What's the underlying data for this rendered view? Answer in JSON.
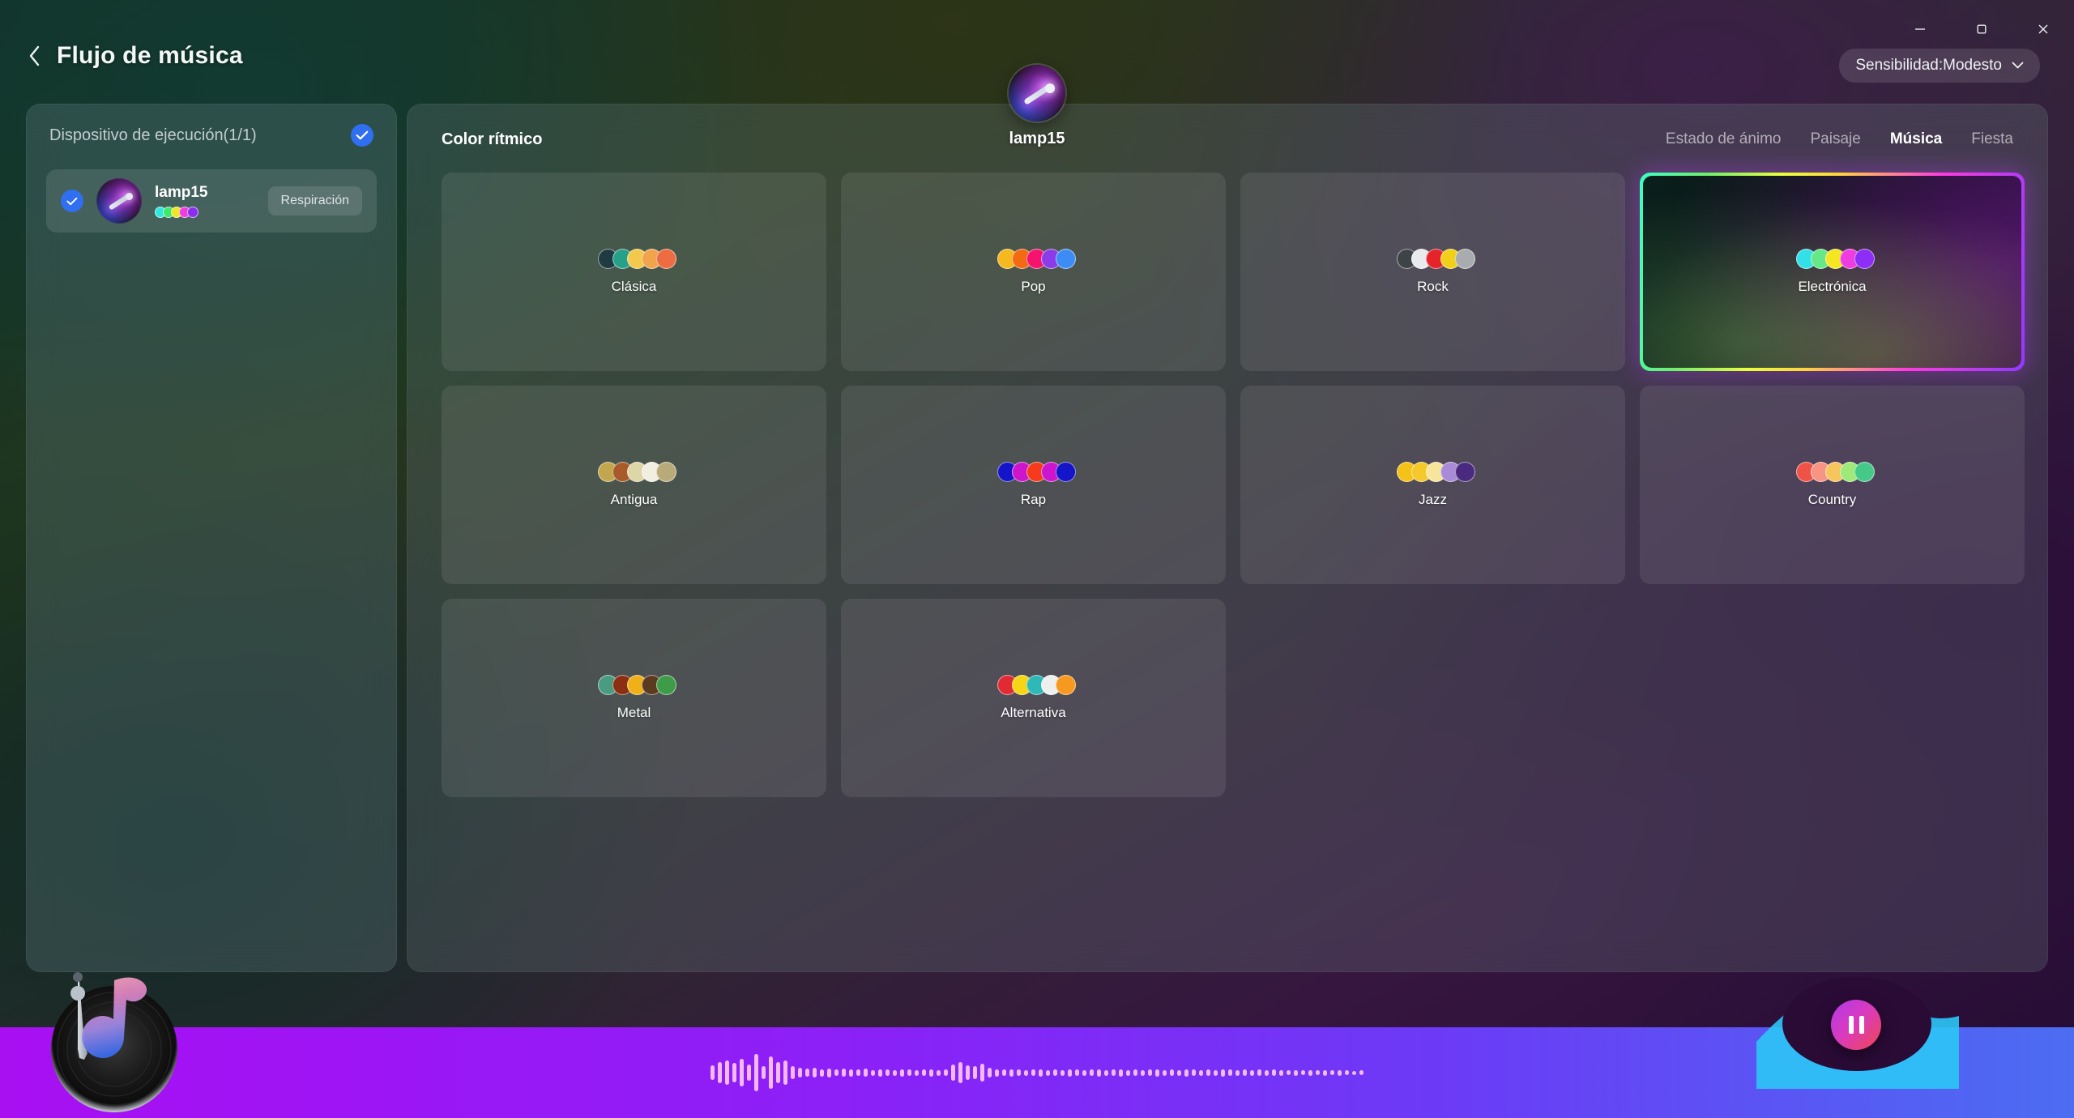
{
  "window": {
    "minimize_label": "Minimizar",
    "maximize_label": "Restaurar",
    "close_label": "Cerrar"
  },
  "header": {
    "back_label": "Atrás",
    "title": "Flujo de música",
    "sensitivity_label": "Sensibilidad:Modesto"
  },
  "sidebar": {
    "devices_title": "Dispositivo de ejecución(1/1)",
    "select_all_checked": true,
    "device": {
      "name": "lamp15",
      "mode_label": "Respiración",
      "checked": true,
      "dots": [
        "#2ee8e0",
        "#3ee86a",
        "#f0e622",
        "#f03ce0",
        "#8a2ef0"
      ]
    }
  },
  "device_header": {
    "name": "lamp15"
  },
  "main": {
    "section_title": "Color rítmico",
    "tabs": [
      {
        "label": "Estado de ánimo",
        "active": false
      },
      {
        "label": "Paisaje",
        "active": false
      },
      {
        "label": "Música",
        "active": true
      },
      {
        "label": "Fiesta",
        "active": false
      }
    ],
    "cards": [
      {
        "name": "Clásica",
        "selected": false,
        "dots": [
          "#1f3a40",
          "#27a08a",
          "#f2c94c",
          "#f2a44c",
          "#ee6c42"
        ]
      },
      {
        "name": "Pop",
        "selected": false,
        "dots": [
          "#f5b81e",
          "#f26b13",
          "#f5136e",
          "#8b3ce8",
          "#3d8cf5"
        ]
      },
      {
        "name": "Rock",
        "selected": false,
        "dots": [
          "#3e4347",
          "#e8eaec",
          "#e6222b",
          "#f2d01a",
          "#a8acae"
        ]
      },
      {
        "name": "Electrónica",
        "selected": true,
        "dots": [
          "#33e0e8",
          "#66e888",
          "#f5e622",
          "#ee3ce0",
          "#8c2ef5"
        ]
      },
      {
        "name": "Antigua",
        "selected": false,
        "dots": [
          "#c2a64e",
          "#a85a2a",
          "#ddd6a6",
          "#f2efe2",
          "#b9ab79"
        ]
      },
      {
        "name": "Rap",
        "selected": false,
        "dots": [
          "#1414c8",
          "#cc15cc",
          "#f53a1e",
          "#cc15cc",
          "#1414c8"
        ]
      },
      {
        "name": "Jazz",
        "selected": false,
        "dots": [
          "#f5c217",
          "#f5c92b",
          "#f7e59c",
          "#a98ad6",
          "#4a2a80"
        ]
      },
      {
        "name": "Country",
        "selected": false,
        "dots": [
          "#ef5346",
          "#f79483",
          "#f7c45e",
          "#9fe87a",
          "#45c988"
        ]
      },
      {
        "name": "Metal",
        "selected": false,
        "dots": [
          "#4a9c80",
          "#8c2e12",
          "#f0b018",
          "#5c3a20",
          "#3e9c48"
        ]
      },
      {
        "name": "Alternativa",
        "selected": false,
        "dots": [
          "#e02b34",
          "#f5d515",
          "#2eb8b8",
          "#eef0f0",
          "#f59a1e"
        ]
      }
    ]
  },
  "player": {
    "play_state_label": "Pausa",
    "waveform": [
      18,
      26,
      30,
      24,
      34,
      20,
      46,
      16,
      40,
      26,
      30,
      16,
      12,
      10,
      12,
      9,
      11,
      8,
      10,
      9,
      8,
      10,
      7,
      9,
      8,
      7,
      9,
      8,
      7,
      8,
      9,
      7,
      8,
      20,
      26,
      18,
      16,
      22,
      12,
      9,
      8,
      9,
      8,
      7,
      8,
      9,
      7,
      8,
      7,
      9,
      8,
      7,
      8,
      9,
      7,
      8,
      9,
      7,
      8,
      7,
      8,
      9,
      7,
      8,
      7,
      9,
      8,
      7,
      8,
      7,
      9,
      8,
      7,
      8,
      7,
      8,
      7,
      8,
      7,
      6,
      7,
      6,
      7,
      6,
      7,
      6,
      7,
      6,
      5,
      6
    ]
  }
}
